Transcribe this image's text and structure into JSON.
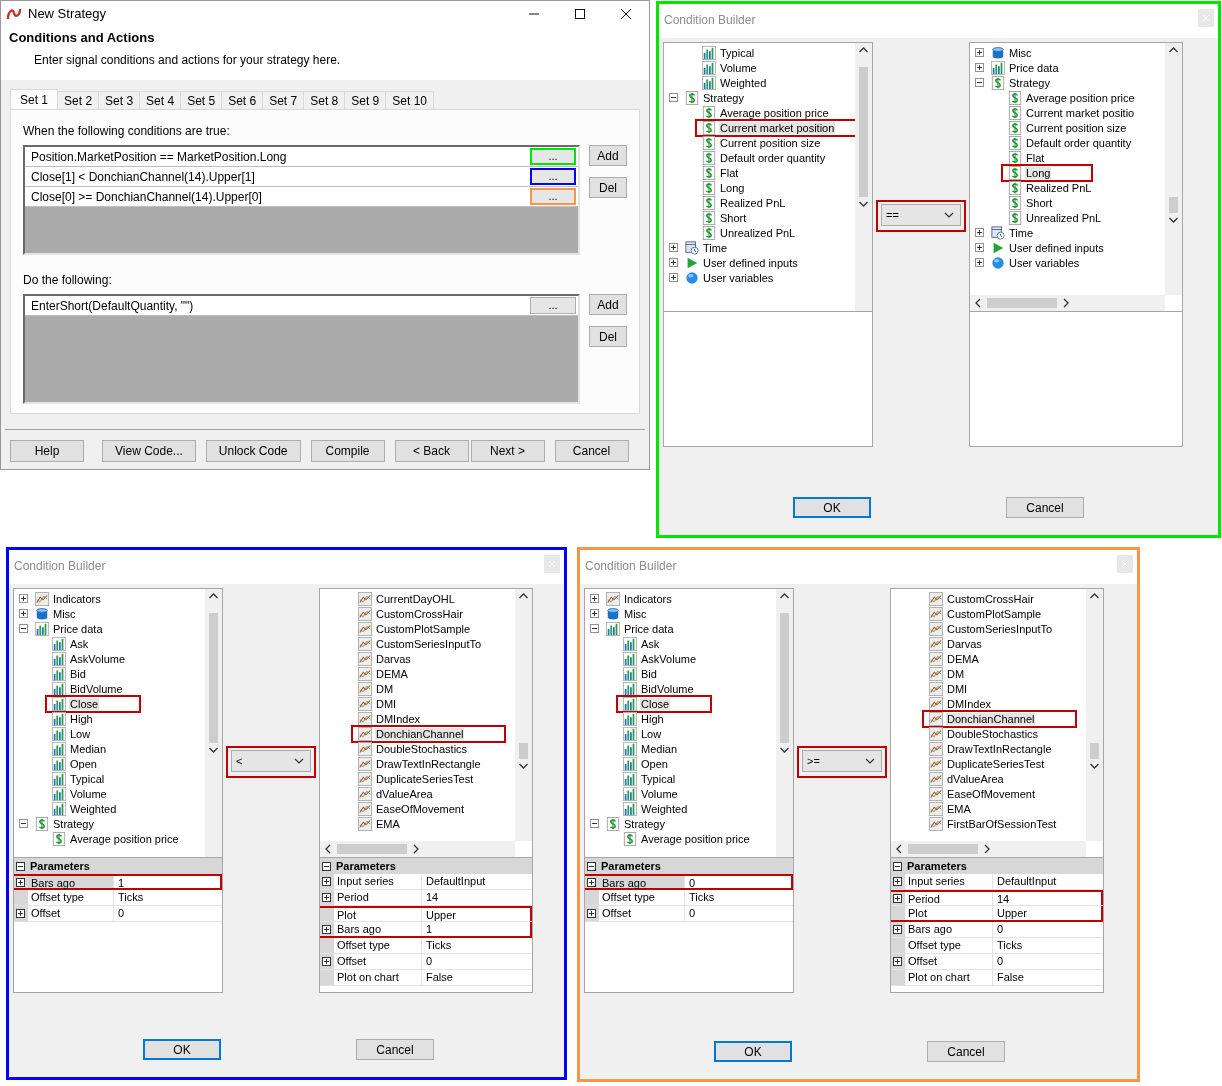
{
  "main_window": {
    "title": "New Strategy",
    "heading": "Conditions and Actions",
    "subtitle": "Enter signal conditions and actions for your strategy here.",
    "tabs": [
      {
        "label": "Set 1",
        "selected": true
      },
      {
        "label": "Set 2",
        "selected": false
      },
      {
        "label": "Set 3",
        "selected": false
      },
      {
        "label": "Set 4",
        "selected": false
      },
      {
        "label": "Set 5",
        "selected": false
      },
      {
        "label": "Set 6",
        "selected": false
      },
      {
        "label": "Set 7",
        "selected": false
      },
      {
        "label": "Set 8",
        "selected": false
      },
      {
        "label": "Set 9",
        "selected": false
      },
      {
        "label": "Set 10",
        "selected": false
      }
    ],
    "conditions_label": "When the following conditions are true:",
    "conditions": [
      {
        "text": "Position.MarketPosition == MarketPosition.Long",
        "button": "...",
        "color": "#00e600"
      },
      {
        "text": "Close[1] < DonchianChannel(14).Upper[1]",
        "button": "...",
        "color": "#0000ff"
      },
      {
        "text": "Close[0] >= DonchianChannel(14).Upper[0]",
        "button": "...",
        "color": "#f79646"
      }
    ],
    "condition_buttons": [
      "Add",
      "Del"
    ],
    "actions_label": "Do the following:",
    "actions": [
      {
        "text": "EnterShort(DefaultQuantity, \"\")",
        "button": "..."
      }
    ],
    "action_buttons": [
      "Add",
      "Del"
    ],
    "footer_buttons": [
      "Help",
      "View Code...",
      "Unlock Code",
      "Compile",
      "< Back",
      "Next >",
      "Cancel"
    ]
  },
  "builders": [
    {
      "title": "Condition Builder",
      "color": "#00e600",
      "operator": "==",
      "ok": "OK",
      "cancel": "Cancel",
      "left": {
        "horizontal_scrollbar": false,
        "tree": [
          {
            "children": [
              {
                "label": "Typical",
                "kind": "price",
                "selected": false
              },
              {
                "label": "Volume",
                "kind": "price",
                "selected": false
              },
              {
                "label": "Weighted",
                "kind": "price",
                "selected": false
              }
            ]
          },
          {
            "label": "Strategy",
            "kind": "strategy",
            "expanded": true,
            "selected": false,
            "children": [
              {
                "label": "Average position price",
                "kind": "strategy",
                "selected": false
              },
              {
                "label": "Current market position",
                "kind": "strategy",
                "selected": true
              },
              {
                "label": "Current position size",
                "kind": "strategy",
                "selected": false
              },
              {
                "label": "Default order quantity",
                "kind": "strategy",
                "selected": false
              },
              {
                "label": "Flat",
                "kind": "strategy",
                "selected": false
              },
              {
                "label": "Long",
                "kind": "strategy",
                "selected": false
              },
              {
                "label": "Realized PnL",
                "kind": "strategy",
                "selected": false
              },
              {
                "label": "Short",
                "kind": "strategy",
                "selected": false
              },
              {
                "label": "Unrealized PnL",
                "kind": "strategy",
                "selected": false
              }
            ]
          },
          {
            "label": "Time",
            "kind": "time",
            "expanded": false,
            "selected": false
          },
          {
            "label": "User defined inputs",
            "kind": "input",
            "expanded": false,
            "selected": false
          },
          {
            "label": "User variables",
            "kind": "variable",
            "expanded": false,
            "selected": false
          }
        ]
      },
      "right": {
        "horizontal_scrollbar": true,
        "tree": [
          {
            "label": "Misc",
            "kind": "misc",
            "expanded": false,
            "selected": false
          },
          {
            "label": "Price data",
            "kind": "price",
            "expanded": false,
            "selected": false
          },
          {
            "label": "Strategy",
            "kind": "strategy",
            "expanded": true,
            "selected": false,
            "children": [
              {
                "label": "Average position price",
                "kind": "strategy",
                "selected": false
              },
              {
                "label": "Current market positio",
                "kind": "strategy",
                "selected": false
              },
              {
                "label": "Current position size",
                "kind": "strategy",
                "selected": false
              },
              {
                "label": "Default order quantity",
                "kind": "strategy",
                "selected": false
              },
              {
                "label": "Flat",
                "kind": "strategy",
                "selected": false
              },
              {
                "label": "Long",
                "kind": "strategy",
                "selected": true
              },
              {
                "label": "Realized PnL",
                "kind": "strategy",
                "selected": false
              },
              {
                "label": "Short",
                "kind": "strategy",
                "selected": false
              },
              {
                "label": "Unrealized PnL",
                "kind": "strategy",
                "selected": false
              }
            ]
          },
          {
            "label": "Time",
            "kind": "time",
            "expanded": false,
            "selected": false
          },
          {
            "label": "User defined inputs",
            "kind": "input",
            "expanded": false,
            "selected": false
          },
          {
            "label": "User variables",
            "kind": "variable",
            "expanded": false,
            "selected": false
          }
        ]
      }
    },
    {
      "title": "Condition Builder",
      "color": "#0000ff",
      "operator": "<",
      "ok": "OK",
      "cancel": "Cancel",
      "left": {
        "horizontal_scrollbar": false,
        "tree": [
          {
            "label": "Indicators",
            "kind": "indicator",
            "expanded": false,
            "selected": false
          },
          {
            "label": "Misc",
            "kind": "misc",
            "expanded": false,
            "selected": false
          },
          {
            "label": "Price data",
            "kind": "price",
            "expanded": true,
            "selected": false,
            "children": [
              {
                "label": "Ask",
                "kind": "price",
                "selected": false
              },
              {
                "label": "AskVolume",
                "kind": "price",
                "selected": false
              },
              {
                "label": "Bid",
                "kind": "price",
                "selected": false
              },
              {
                "label": "BidVolume",
                "kind": "price",
                "selected": false
              },
              {
                "label": "Close",
                "kind": "price",
                "selected": true
              },
              {
                "label": "High",
                "kind": "price",
                "selected": false
              },
              {
                "label": "Low",
                "kind": "price",
                "selected": false
              },
              {
                "label": "Median",
                "kind": "price",
                "selected": false
              },
              {
                "label": "Open",
                "kind": "price",
                "selected": false
              },
              {
                "label": "Typical",
                "kind": "price",
                "selected": false
              },
              {
                "label": "Volume",
                "kind": "price",
                "selected": false
              },
              {
                "label": "Weighted",
                "kind": "price",
                "selected": false
              }
            ]
          },
          {
            "label": "Strategy",
            "kind": "strategy",
            "expanded": true,
            "selected": false,
            "children": [
              {
                "label": "Average position price",
                "kind": "strategy",
                "selected": false
              }
            ]
          }
        ],
        "parameters_title": "Parameters",
        "parameters": [
          {
            "name": "Bars ago",
            "value": "1",
            "expandable": true,
            "selected": true,
            "highlighted": true
          },
          {
            "name": "Offset type",
            "value": "Ticks",
            "expandable": false,
            "selected": false,
            "highlighted": false
          },
          {
            "name": "Offset",
            "value": "0",
            "expandable": true,
            "selected": false,
            "highlighted": false
          }
        ]
      },
      "right": {
        "horizontal_scrollbar": true,
        "tree": [
          {
            "children": [
              {
                "label": "CurrentDayOHL",
                "kind": "indicator",
                "selected": false
              },
              {
                "label": "CustomCrossHair",
                "kind": "indicator",
                "selected": false
              },
              {
                "label": "CustomPlotSample",
                "kind": "indicator",
                "selected": false
              },
              {
                "label": "CustomSeriesInputTo",
                "kind": "indicator",
                "selected": false
              },
              {
                "label": "Darvas",
                "kind": "indicator",
                "selected": false
              },
              {
                "label": "DEMA",
                "kind": "indicator",
                "selected": false
              },
              {
                "label": "DM",
                "kind": "indicator",
                "selected": false
              },
              {
                "label": "DMI",
                "kind": "indicator",
                "selected": false
              },
              {
                "label": "DMIndex",
                "kind": "indicator",
                "selected": false
              },
              {
                "label": "DonchianChannel",
                "kind": "indicator",
                "selected": true
              },
              {
                "label": "DoubleStochastics",
                "kind": "indicator",
                "selected": false
              },
              {
                "label": "DrawTextInRectangle",
                "kind": "indicator",
                "selected": false
              },
              {
                "label": "DuplicateSeriesTest",
                "kind": "indicator",
                "selected": false
              },
              {
                "label": "dValueArea",
                "kind": "indicator",
                "selected": false
              },
              {
                "label": "EaseOfMovement",
                "kind": "indicator",
                "selected": false
              },
              {
                "label": "EMA",
                "kind": "indicator",
                "selected": false
              }
            ]
          }
        ],
        "parameters_title": "Parameters",
        "parameters": [
          {
            "name": "Input series",
            "value": "DefaultInput",
            "expandable": true,
            "selected": false,
            "highlighted": false
          },
          {
            "name": "Period",
            "value": "14",
            "expandable": true,
            "selected": false,
            "highlighted": false
          },
          {
            "name": "Plot",
            "value": "Upper",
            "expandable": false,
            "selected": false,
            "highlighted": true
          },
          {
            "name": "Bars ago",
            "value": "1",
            "expandable": true,
            "selected": false,
            "highlighted": true
          },
          {
            "name": "Offset type",
            "value": "Ticks",
            "expandable": false,
            "selected": false,
            "highlighted": false
          },
          {
            "name": "Offset",
            "value": "0",
            "expandable": true,
            "selected": false,
            "highlighted": false
          },
          {
            "name": "Plot on chart",
            "value": "False",
            "expandable": false,
            "selected": false,
            "highlighted": false
          }
        ]
      }
    },
    {
      "title": "Condition Builder",
      "color": "#f79646",
      "operator": ">=",
      "ok": "OK",
      "cancel": "Cancel",
      "left": {
        "horizontal_scrollbar": false,
        "tree": [
          {
            "label": "Indicators",
            "kind": "indicator",
            "expanded": false,
            "selected": false
          },
          {
            "label": "Misc",
            "kind": "misc",
            "expanded": false,
            "selected": false
          },
          {
            "label": "Price data",
            "kind": "price",
            "expanded": true,
            "selected": false,
            "children": [
              {
                "label": "Ask",
                "kind": "price",
                "selected": false
              },
              {
                "label": "AskVolume",
                "kind": "price",
                "selected": false
              },
              {
                "label": "Bid",
                "kind": "price",
                "selected": false
              },
              {
                "label": "BidVolume",
                "kind": "price",
                "selected": false
              },
              {
                "label": "Close",
                "kind": "price",
                "selected": true
              },
              {
                "label": "High",
                "kind": "price",
                "selected": false
              },
              {
                "label": "Low",
                "kind": "price",
                "selected": false
              },
              {
                "label": "Median",
                "kind": "price",
                "selected": false
              },
              {
                "label": "Open",
                "kind": "price",
                "selected": false
              },
              {
                "label": "Typical",
                "kind": "price",
                "selected": false
              },
              {
                "label": "Volume",
                "kind": "price",
                "selected": false
              },
              {
                "label": "Weighted",
                "kind": "price",
                "selected": false
              }
            ]
          },
          {
            "label": "Strategy",
            "kind": "strategy",
            "expanded": true,
            "selected": false,
            "children": [
              {
                "label": "Average position price",
                "kind": "strategy",
                "selected": false
              }
            ]
          }
        ],
        "parameters_title": "Parameters",
        "parameters": [
          {
            "name": "Bars ago",
            "value": "0",
            "expandable": true,
            "selected": true,
            "highlighted": true
          },
          {
            "name": "Offset type",
            "value": "Ticks",
            "expandable": false,
            "selected": false,
            "highlighted": false
          },
          {
            "name": "Offset",
            "value": "0",
            "expandable": true,
            "selected": false,
            "highlighted": false
          }
        ]
      },
      "right": {
        "horizontal_scrollbar": true,
        "tree": [
          {
            "children": [
              {
                "label": "CustomCrossHair",
                "kind": "indicator",
                "selected": false
              },
              {
                "label": "CustomPlotSample",
                "kind": "indicator",
                "selected": false
              },
              {
                "label": "CustomSeriesInputTo",
                "kind": "indicator",
                "selected": false
              },
              {
                "label": "Darvas",
                "kind": "indicator",
                "selected": false
              },
              {
                "label": "DEMA",
                "kind": "indicator",
                "selected": false
              },
              {
                "label": "DM",
                "kind": "indicator",
                "selected": false
              },
              {
                "label": "DMI",
                "kind": "indicator",
                "selected": false
              },
              {
                "label": "DMIndex",
                "kind": "indicator",
                "selected": false
              },
              {
                "label": "DonchianChannel",
                "kind": "indicator",
                "selected": true
              },
              {
                "label": "DoubleStochastics",
                "kind": "indicator",
                "selected": false
              },
              {
                "label": "DrawTextInRectangle",
                "kind": "indicator",
                "selected": false
              },
              {
                "label": "DuplicateSeriesTest",
                "kind": "indicator",
                "selected": false
              },
              {
                "label": "dValueArea",
                "kind": "indicator",
                "selected": false
              },
              {
                "label": "EaseOfMovement",
                "kind": "indicator",
                "selected": false
              },
              {
                "label": "EMA",
                "kind": "indicator",
                "selected": false
              },
              {
                "label": "FirstBarOfSessionTest",
                "kind": "indicator",
                "selected": false
              }
            ]
          }
        ],
        "parameters_title": "Parameters",
        "parameters": [
          {
            "name": "Input series",
            "value": "DefaultInput",
            "expandable": true,
            "selected": false,
            "highlighted": false
          },
          {
            "name": "Period",
            "value": "14",
            "expandable": true,
            "selected": false,
            "highlighted": true
          },
          {
            "name": "Plot",
            "value": "Upper",
            "expandable": false,
            "selected": false,
            "highlighted": true
          },
          {
            "name": "Bars ago",
            "value": "0",
            "expandable": true,
            "selected": false,
            "highlighted": false
          },
          {
            "name": "Offset type",
            "value": "Ticks",
            "expandable": false,
            "selected": false,
            "highlighted": false
          },
          {
            "name": "Offset",
            "value": "0",
            "expandable": true,
            "selected": false,
            "highlighted": false
          },
          {
            "name": "Plot on chart",
            "value": "False",
            "expandable": false,
            "selected": false,
            "highlighted": false
          }
        ]
      }
    }
  ]
}
